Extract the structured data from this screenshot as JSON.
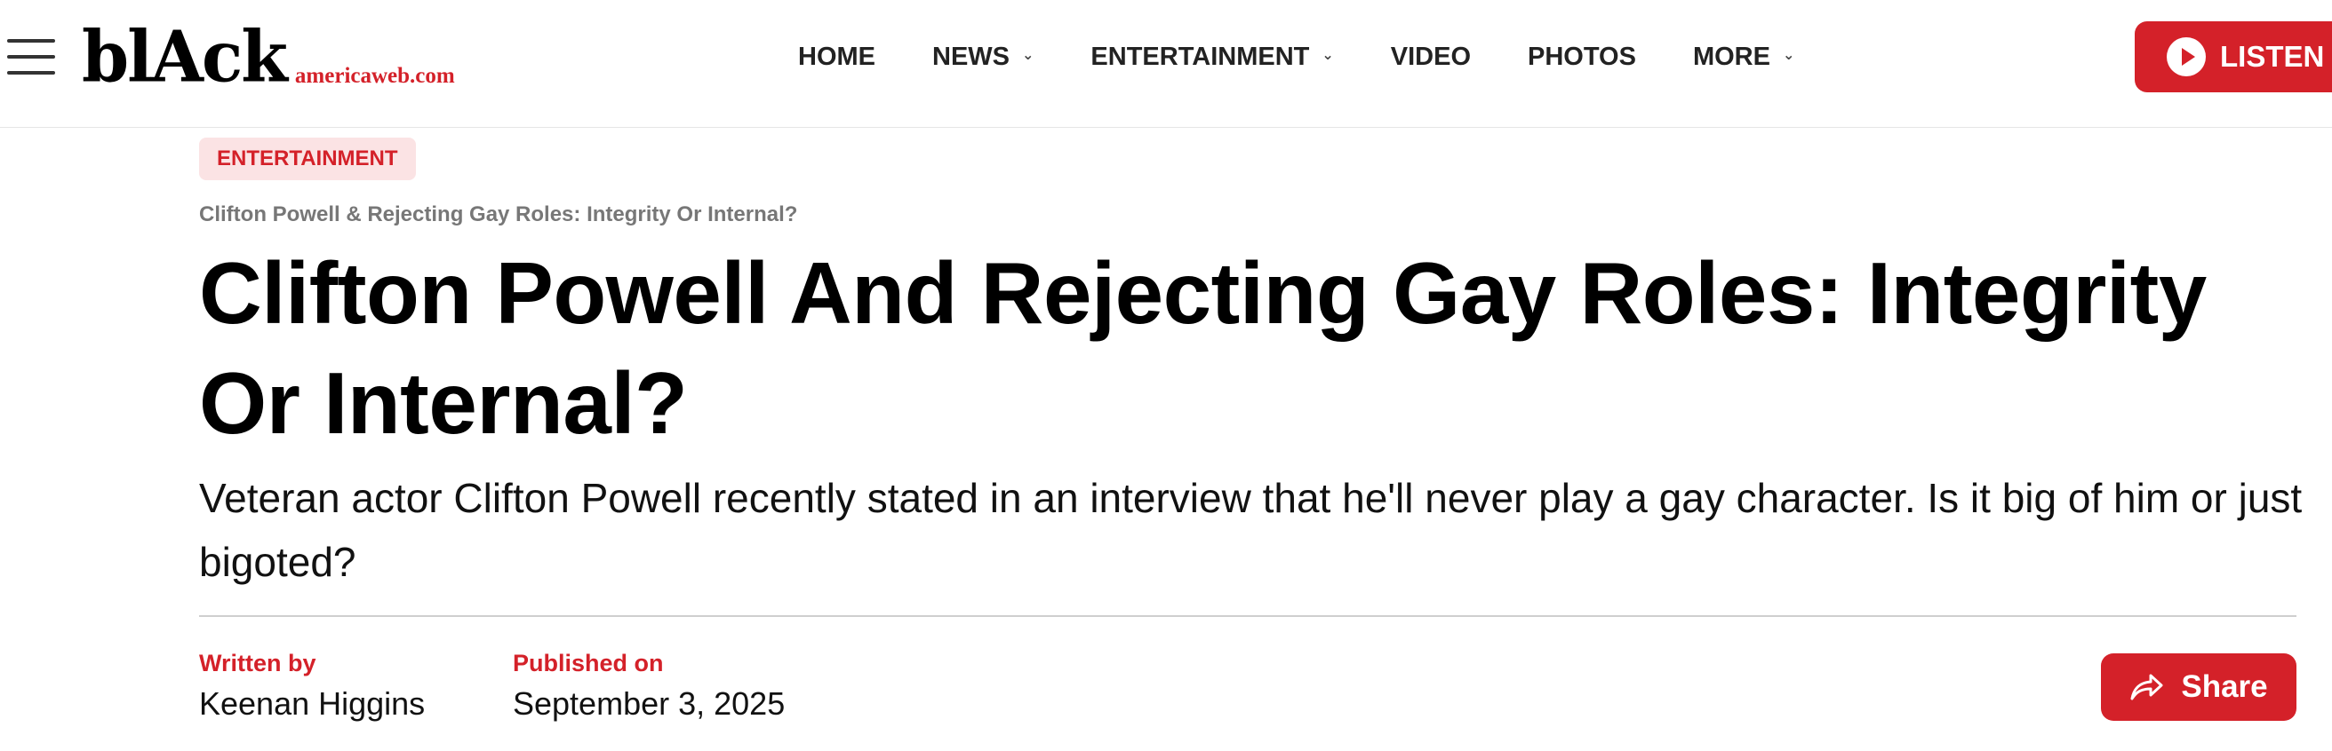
{
  "header": {
    "logo_main": "blAck",
    "logo_sub": "americaweb.com",
    "nav": [
      {
        "label": "HOME",
        "has_dropdown": false
      },
      {
        "label": "NEWS",
        "has_dropdown": true
      },
      {
        "label": "ENTERTAINMENT",
        "has_dropdown": true
      },
      {
        "label": "VIDEO",
        "has_dropdown": false
      },
      {
        "label": "PHOTOS",
        "has_dropdown": false
      },
      {
        "label": "MORE",
        "has_dropdown": true
      }
    ],
    "listen_label": "LISTEN"
  },
  "article": {
    "category": "ENTERTAINMENT",
    "breadcrumb": "Clifton Powell & Rejecting Gay Roles: Integrity Or Internal?",
    "headline": "Clifton Powell And Rejecting Gay Roles: Integrity Or Internal?",
    "dek": "Veteran actor Clifton Powell recently stated in an interview that he'll never play a gay character. Is it big of him or just bigoted?",
    "written_by_label": "Written by",
    "author": "Keenan Higgins",
    "published_label": "Published on",
    "published_date": "September 3, 2025",
    "share_label": "Share"
  },
  "colors": {
    "brand_red": "#d42129",
    "tag_background": "#fbe3e4",
    "breadcrumb_gray": "#777777"
  },
  "icons": {
    "menu": "hamburger-icon",
    "play": "play-icon",
    "share": "share-arrow-icon",
    "dropdown": "chevron-down-icon"
  }
}
